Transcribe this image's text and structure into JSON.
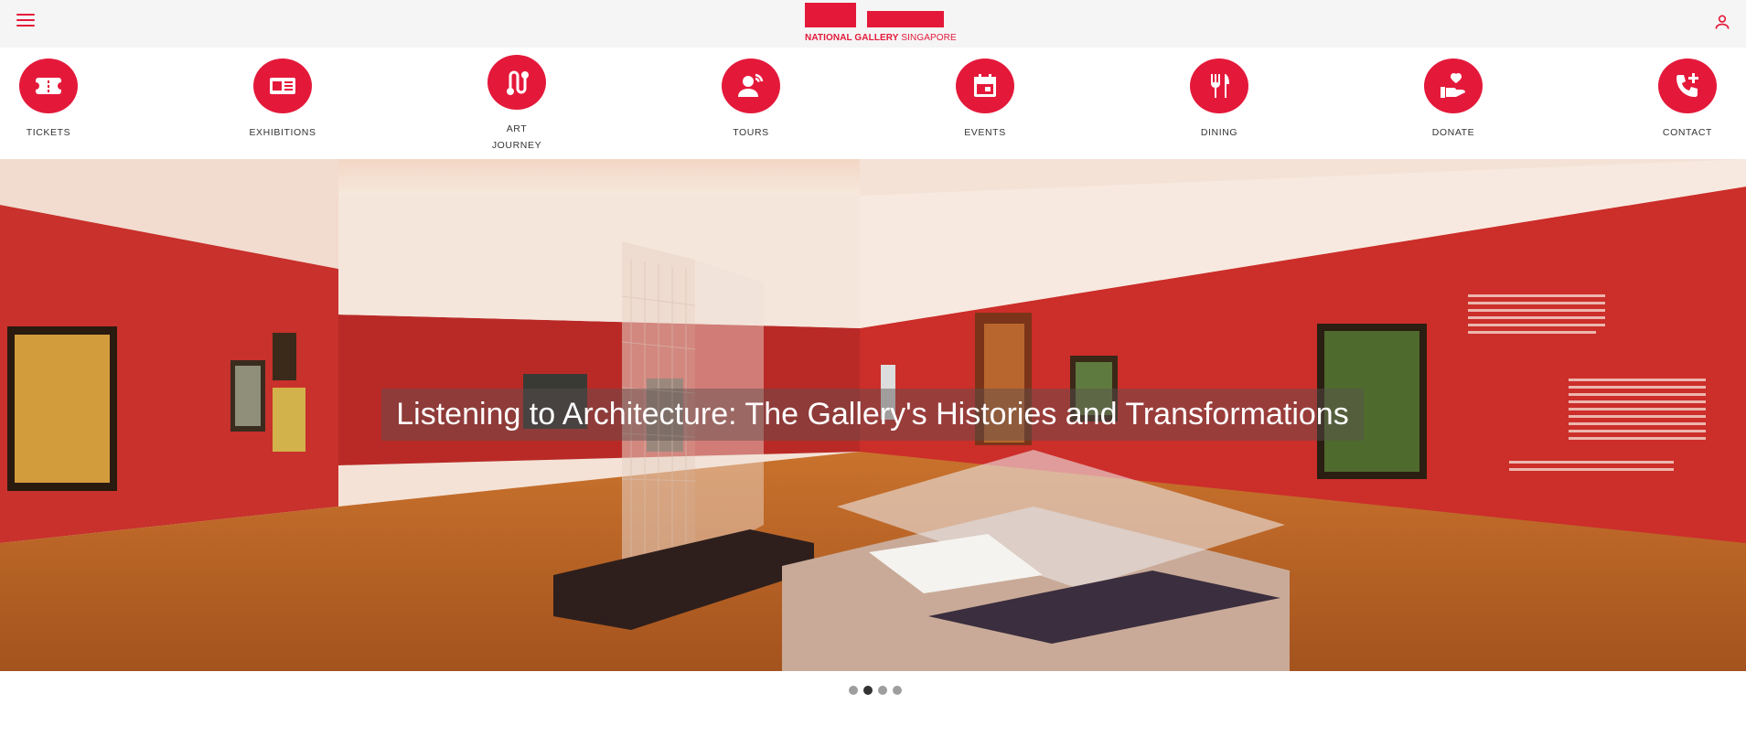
{
  "colors": {
    "accent": "#e4193a",
    "header_bg": "#f5f5f5",
    "label": "#333333"
  },
  "header": {
    "menu_icon": "hamburger-menu-icon",
    "logo": {
      "bold": "NATIONAL GALLERY",
      "light": " SINGAPORE"
    },
    "user_icon": "user-account-icon"
  },
  "quicklinks": [
    {
      "label": "TICKETS",
      "icon": "ticket-icon"
    },
    {
      "label": "EXHIBITIONS",
      "icon": "exhibition-card-icon"
    },
    {
      "label": "ART JOURNEY",
      "icon": "route-journey-icon"
    },
    {
      "label": "TOURS",
      "icon": "tour-guide-icon"
    },
    {
      "label": "EVENTS",
      "icon": "calendar-icon"
    },
    {
      "label": "DINING",
      "icon": "fork-knife-icon"
    },
    {
      "label": "DONATE",
      "icon": "heart-hand-icon"
    },
    {
      "label": "CONTACT",
      "icon": "phone-add-icon"
    }
  ],
  "hero": {
    "title": "Listening to Architecture: The Gallery's Histories and Transformations",
    "image_description": "gallery-room-photo"
  },
  "carousel": {
    "slides": 4,
    "active": 2
  }
}
